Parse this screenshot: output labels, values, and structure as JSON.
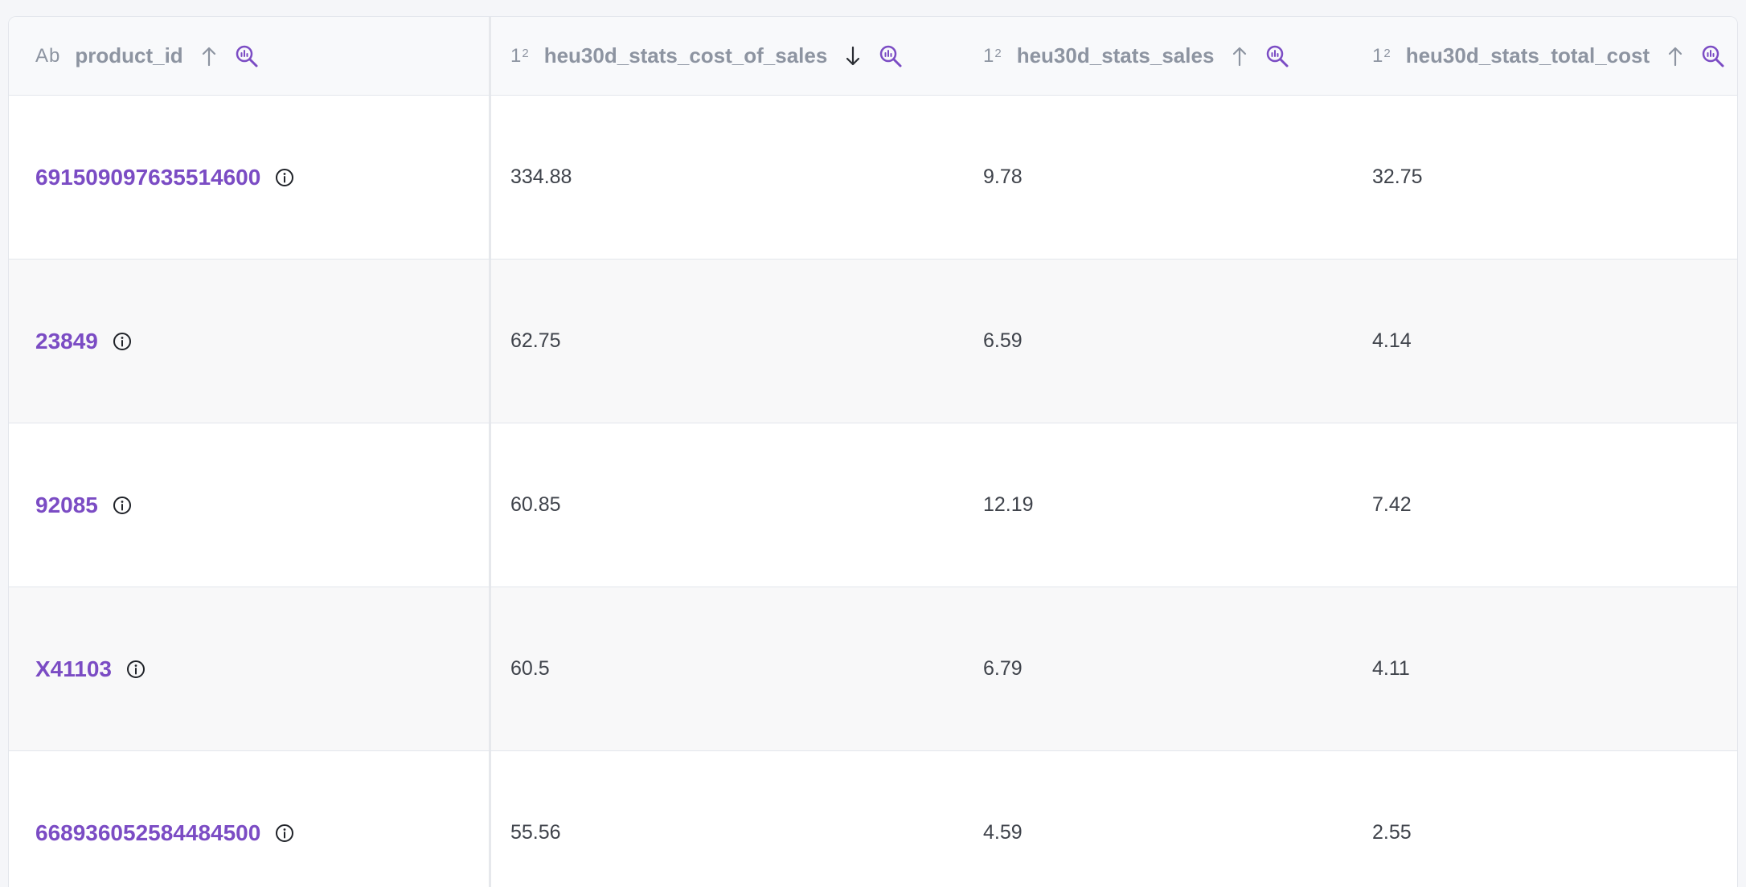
{
  "columns": [
    {
      "label": "product_id",
      "type_icon": "text-type-icon",
      "sort": "ascending"
    },
    {
      "label": "heu30d_stats_cost_of_sales",
      "type_icon": "number-type-icon",
      "sort": "descending"
    },
    {
      "label": "heu30d_stats_sales",
      "type_icon": "number-type-icon",
      "sort": "ascending"
    },
    {
      "label": "heu30d_stats_total_cost",
      "type_icon": "number-type-icon",
      "sort": "ascending"
    }
  ],
  "type_glyphs": {
    "text": "Ab",
    "number_main": "1",
    "number_sup": "2"
  },
  "rows": [
    {
      "product_id": "691509097635514600",
      "cost_of_sales": "334.88",
      "sales": "9.78",
      "total_cost": "32.75"
    },
    {
      "product_id": "23849",
      "cost_of_sales": "62.75",
      "sales": "6.59",
      "total_cost": "4.14"
    },
    {
      "product_id": "92085",
      "cost_of_sales": "60.85",
      "sales": "12.19",
      "total_cost": "7.42"
    },
    {
      "product_id": "X41103",
      "cost_of_sales": "60.5",
      "sales": "6.79",
      "total_cost": "4.11"
    },
    {
      "product_id": "668936052584484500",
      "cost_of_sales": "55.56",
      "sales": "4.59",
      "total_cost": "2.55"
    }
  ],
  "colors": {
    "accent": "#7b4cc4",
    "header_text": "#8d94a1",
    "border": "#e3e6ec"
  }
}
